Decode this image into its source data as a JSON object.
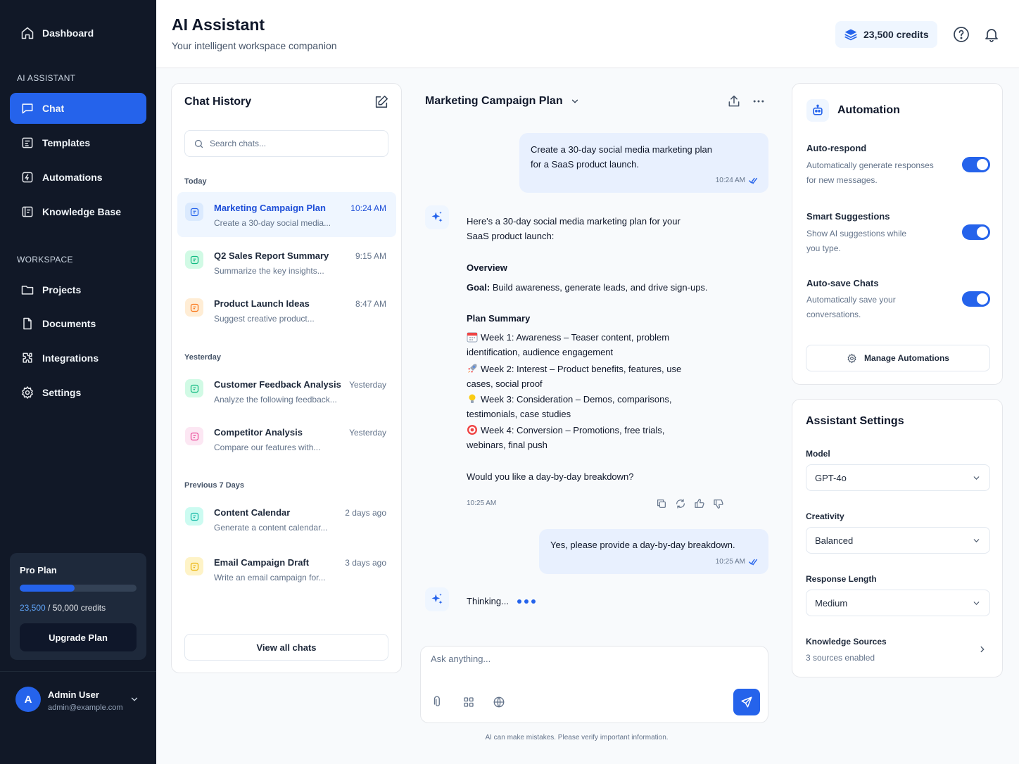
{
  "sidebar": {
    "dashboard": "Dashboard",
    "section_ai": "AI ASSISTANT",
    "section_workspace": "WORKSPACE",
    "items": {
      "chat": "Chat",
      "templates": "Templates",
      "automations": "Automations",
      "knowledge_base": "Knowledge Base",
      "projects": "Projects",
      "documents": "Documents",
      "integrations": "Integrations",
      "settings": "Settings"
    },
    "plan": {
      "title": "Pro Plan",
      "used": "23,500",
      "total": "/ 50,000 credits",
      "progress_fraction": 0.47,
      "upgrade_label": "Upgrade Plan"
    },
    "user": {
      "initial": "A",
      "name": "Admin User",
      "email": "admin@example.com"
    }
  },
  "header": {
    "title": "AI Assistant",
    "subtitle": "Your intelligent workspace companion",
    "credits": "23,500 credits"
  },
  "history": {
    "title": "Chat History",
    "search_placeholder": "Search chats...",
    "groups": {
      "today": "Today",
      "yesterday": "Yesterday",
      "previous": "Previous 7 Days"
    },
    "items": [
      {
        "title": "Marketing Campaign Plan",
        "preview": "Create a 30-day social media...",
        "time": "10:24 AM",
        "color": "#2563eb",
        "bg": "#dbeafe"
      },
      {
        "title": "Q2 Sales Report Summary",
        "preview": "Summarize the key insights...",
        "time": "9:15 AM",
        "color": "#10b981",
        "bg": "#d1fae5"
      },
      {
        "title": "Product Launch Ideas",
        "preview": "Suggest creative product...",
        "time": "8:47 AM",
        "color": "#f97316",
        "bg": "#ffedd5"
      },
      {
        "title": "Customer Feedback Analysis",
        "preview": "Analyze the following feedback...",
        "time": "Yesterday",
        "color": "#10b981",
        "bg": "#d1fae5"
      },
      {
        "title": "Competitor Analysis",
        "preview": "Compare our features with...",
        "time": "Yesterday",
        "color": "#ec4899",
        "bg": "#fce7f3"
      },
      {
        "title": "Content Calendar",
        "preview": "Generate a content calendar...",
        "time": "2 days ago",
        "color": "#14b8a6",
        "bg": "#ccfbf1"
      },
      {
        "title": "Email Campaign Draft",
        "preview": "Write an email campaign for...",
        "time": "3 days ago",
        "color": "#eab308",
        "bg": "#fef3c7"
      }
    ],
    "view_all": "View all chats"
  },
  "conversation": {
    "title": "Marketing Campaign Plan",
    "user_msg_1": {
      "line1": "Create a 30-day social media marketing plan",
      "line2": "for a SaaS product launch.",
      "time": "10:24 AM"
    },
    "ai_msg": {
      "intro1": "Here's a 30-day social media marketing plan for your",
      "intro2": "SaaS product launch:",
      "overview_heading": "Overview",
      "goal_label": "Goal:",
      "goal_text": "Build awareness, generate leads, and drive sign-ups.",
      "summary_heading": "Plan Summary",
      "weeks": [
        {
          "label": "Week 1: Awareness",
          "rest1": " – Teaser content, problem",
          "rest2": "identification, audience engagement"
        },
        {
          "label": "Week 2: Interest",
          "rest1": " – Product benefits, features, use",
          "rest2": "cases, social proof"
        },
        {
          "label": "Week 3: Consideration",
          "rest1": " – Demos, comparisons,",
          "rest2": "testimonials, case studies"
        },
        {
          "label": "Week 4: Conversion",
          "rest1": " – Promotions, free trials,",
          "rest2": "webinars, final push"
        }
      ],
      "closing": "Would you like a day-by-day breakdown?",
      "time": "10:25 AM"
    },
    "user_msg_2": {
      "text": "Yes, please provide a day-by-day breakdown.",
      "time": "10:25 AM"
    },
    "thinking": "Thinking...",
    "composer_placeholder": "Ask anything...",
    "disclaimer": "AI can make mistakes. Please verify important information."
  },
  "automation": {
    "title": "Automation",
    "settings": [
      {
        "name": "Auto-respond",
        "desc1": "Automatically generate responses",
        "desc2": "for new messages.",
        "enabled": true
      },
      {
        "name": "Smart Suggestions",
        "desc1": "Show AI suggestions while",
        "desc2": "you type.",
        "enabled": true
      },
      {
        "name": "Auto-save Chats",
        "desc1": "Automatically save your",
        "desc2": "conversations.",
        "enabled": true
      }
    ],
    "manage_label": "Manage Automations"
  },
  "assistant_settings": {
    "title": "Assistant Settings",
    "model_label": "Model",
    "model_value": "GPT-4o",
    "creativity_label": "Creativity",
    "creativity_value": "Balanced",
    "length_label": "Response Length",
    "length_value": "Medium",
    "knowledge_label": "Knowledge Sources",
    "knowledge_sub": "3 sources enabled"
  },
  "colors": {
    "accent": "#2563eb",
    "sidebar_bg": "#111827",
    "user_bubble": "#e8f0fe"
  }
}
